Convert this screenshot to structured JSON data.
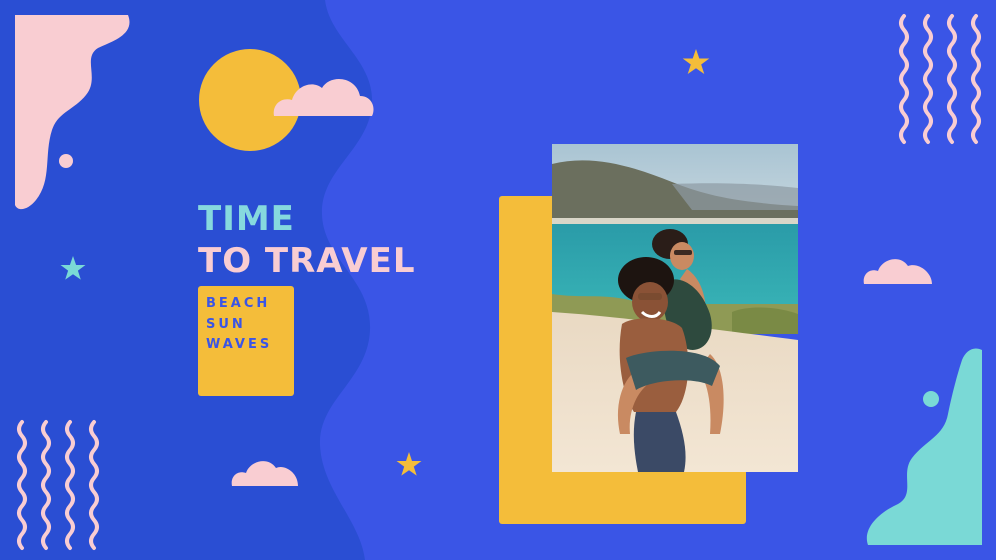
{
  "headline": {
    "line1": "TIME",
    "line2": "TO TRAVEL"
  },
  "tagline": {
    "word1": "BEACH",
    "word2": "SUN",
    "word3": "WAVES"
  },
  "colors": {
    "left_panel": "#2a4ed3",
    "right_panel": "#3a55e6",
    "accent_yellow": "#f4bd3a",
    "pink": "#f9cdd2",
    "mint": "#7ad9d6",
    "headline_line1": "#86d9de",
    "headline_line2": "#f9cdd2",
    "tagline_text": "#3a55e6"
  },
  "icons": {
    "sun": "sun-icon",
    "cloud": "cloud-icon",
    "star": "star-icon",
    "squiggle": "wavy-lines-icon"
  }
}
